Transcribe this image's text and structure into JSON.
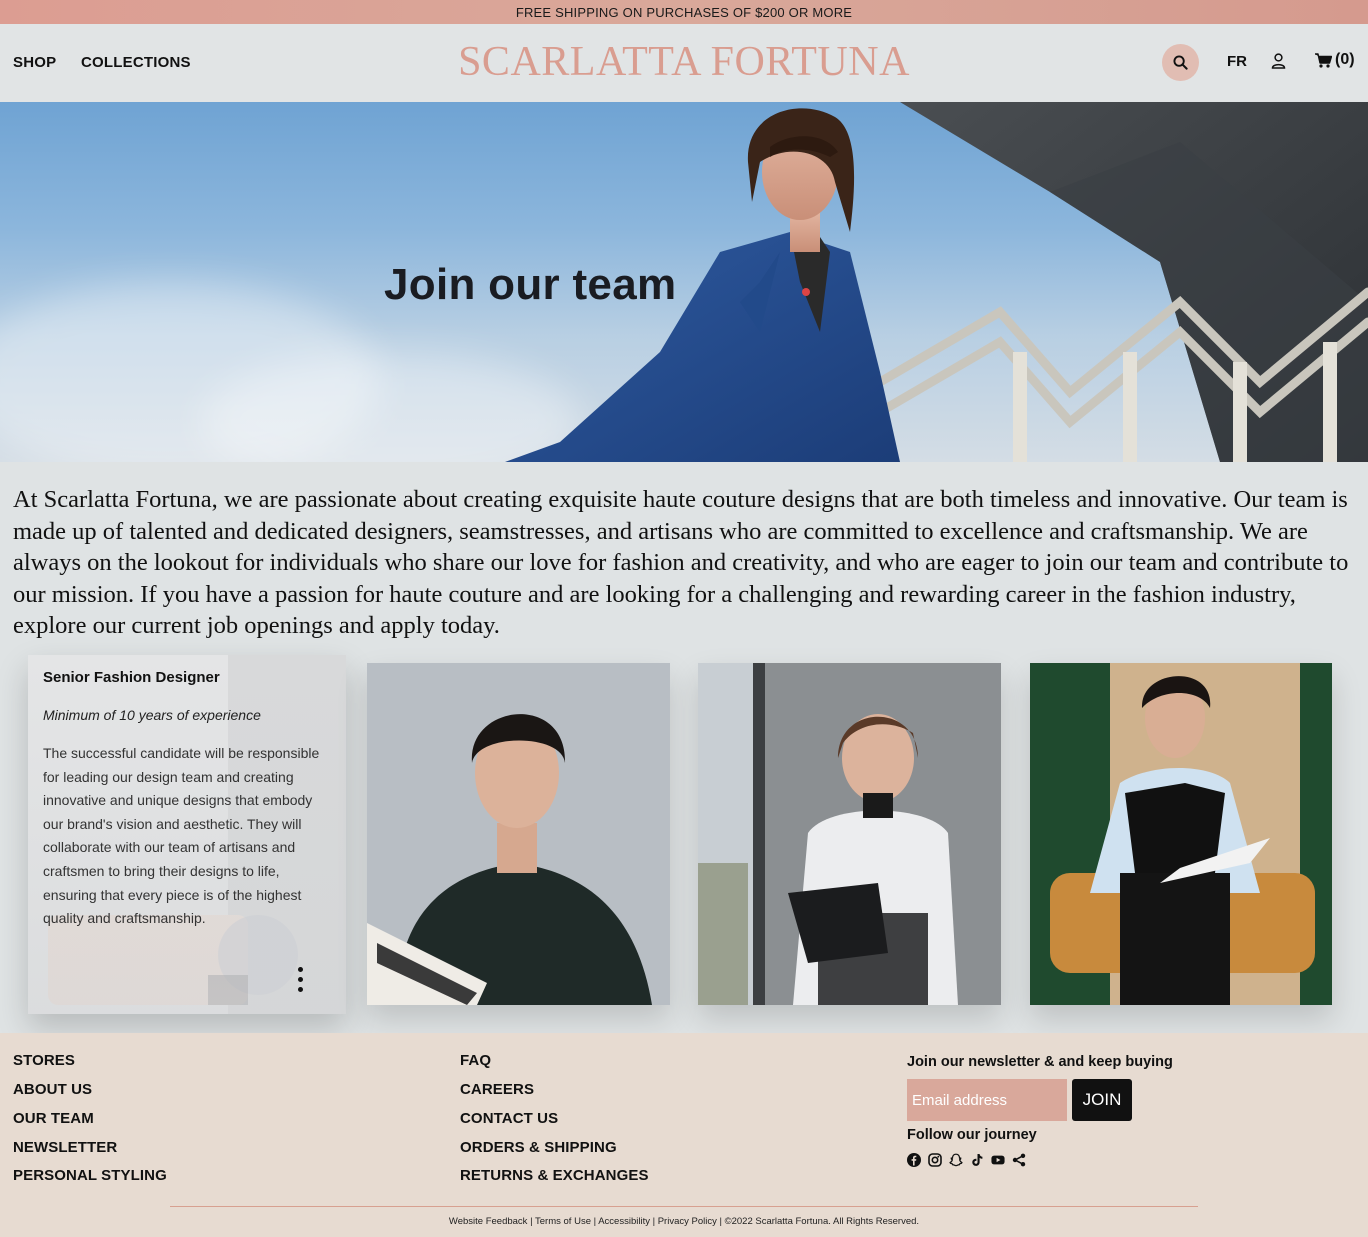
{
  "promo": {
    "text": "FREE SHIPPING ON PURCHASES OF $200 OR MORE"
  },
  "header": {
    "nav": [
      "SHOP",
      "COLLECTIONS"
    ],
    "logo": "SCARLATTA FORTUNA",
    "lang": "FR",
    "cart_count": "(0)",
    "icons": [
      "search-icon",
      "user-icon",
      "cart-icon"
    ],
    "search_bg": "#e1bdb3"
  },
  "hero": {
    "title": "Join our team"
  },
  "intro": {
    "text": "At Scarlatta Fortuna, we are passionate about creating exquisite haute couture designs that are both timeless and innovative. Our team is made up of talented and dedicated designers, seamstresses, and artisans who are committed to excellence and craftsmanship. We are always on the lookout for individuals who share our love for fashion and creativity, and who are eager to join our team and contribute to our mission. If you have a passion for haute couture and are looking for a challenging and rewarding career in the fashion industry, explore our current job openings and apply today."
  },
  "job": {
    "title": "Senior Fashion Designer",
    "experience": "Minimum of 10 years of experience",
    "description": "The successful candidate will be responsible for leading our design team and creating innovative and unique designs that embody our brand's vision and aesthetic. They will collaborate with our team of artisans and craftsmen to bring their designs to life, ensuring that every piece is of the highest quality and craftsmanship."
  },
  "footer": {
    "col1": [
      "STORES",
      "ABOUT US",
      "OUR TEAM",
      "NEWSLETTER",
      "PERSONAL STYLING"
    ],
    "col2": [
      "FAQ",
      "CAREERS",
      "CONTACT US",
      "ORDERS & SHIPPING",
      "RETURNS & EXCHANGES"
    ],
    "newsletter_label": "Join our newsletter & and keep buying",
    "email_placeholder": "Email address",
    "join_label": "JOIN",
    "follow_label": "Follow our journey",
    "socials": [
      "facebook-icon",
      "instagram-icon",
      "snapchat-icon",
      "tiktok-icon",
      "youtube-icon",
      "share-icon"
    ],
    "legal": {
      "feedback": "Website Feedback",
      "terms": "Terms of Use",
      "accessibility": "Accessibility",
      "privacy": "Privacy Policy",
      "copyright": "©2022 Scarlatta Fortuna. All Rights Reserved."
    }
  },
  "colors": {
    "accent": "#d99d90",
    "footer_bg": "#e7dbd1",
    "page_bg": "#dfe3e4"
  }
}
